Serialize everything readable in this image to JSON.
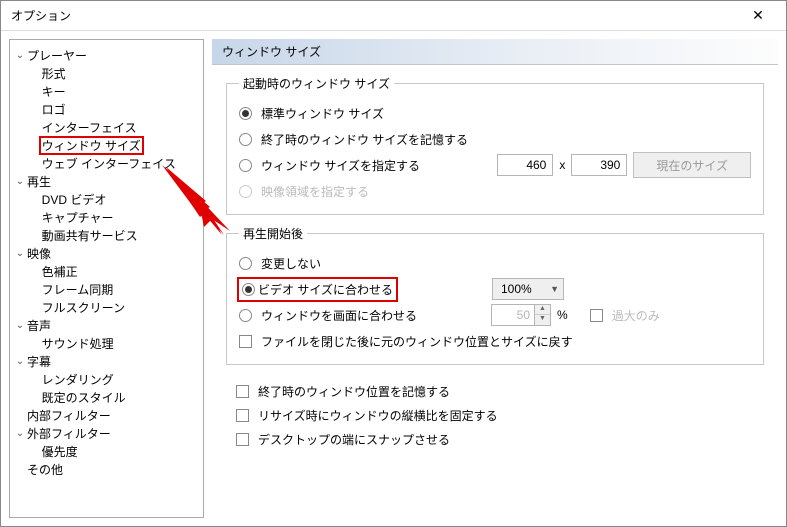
{
  "window": {
    "title": "オプション"
  },
  "tree": {
    "items": [
      {
        "depth": 0,
        "expand": "open",
        "label": "プレーヤー"
      },
      {
        "depth": 1,
        "expand": "",
        "label": "形式"
      },
      {
        "depth": 1,
        "expand": "",
        "label": "キー"
      },
      {
        "depth": 1,
        "expand": "",
        "label": "ロゴ"
      },
      {
        "depth": 1,
        "expand": "",
        "label": "インターフェイス"
      },
      {
        "depth": 1,
        "expand": "",
        "label": "ウィンドウ サイズ",
        "selected": true
      },
      {
        "depth": 1,
        "expand": "",
        "label": "ウェブ インターフェイス"
      },
      {
        "depth": 0,
        "expand": "open",
        "label": "再生"
      },
      {
        "depth": 1,
        "expand": "",
        "label": "DVD ビデオ"
      },
      {
        "depth": 1,
        "expand": "",
        "label": "キャプチャー"
      },
      {
        "depth": 1,
        "expand": "",
        "label": "動画共有サービス"
      },
      {
        "depth": 0,
        "expand": "open",
        "label": "映像"
      },
      {
        "depth": 1,
        "expand": "",
        "label": "色補正"
      },
      {
        "depth": 1,
        "expand": "",
        "label": "フレーム同期"
      },
      {
        "depth": 1,
        "expand": "",
        "label": "フルスクリーン"
      },
      {
        "depth": 0,
        "expand": "open",
        "label": "音声"
      },
      {
        "depth": 1,
        "expand": "",
        "label": "サウンド処理"
      },
      {
        "depth": 0,
        "expand": "open",
        "label": "字幕"
      },
      {
        "depth": 1,
        "expand": "",
        "label": "レンダリング"
      },
      {
        "depth": 1,
        "expand": "",
        "label": "既定のスタイル"
      },
      {
        "depth": 0,
        "expand": "",
        "label": "内部フィルター"
      },
      {
        "depth": 0,
        "expand": "open",
        "label": "外部フィルター"
      },
      {
        "depth": 1,
        "expand": "",
        "label": "優先度"
      },
      {
        "depth": 0,
        "expand": "",
        "label": "その他"
      }
    ]
  },
  "panel": {
    "header": "ウィンドウ サイズ",
    "group_startup": {
      "legend": "起動時のウィンドウ サイズ",
      "opt_standard": "標準ウィンドウ サイズ",
      "opt_last_exit": "終了時のウィンドウ サイズを記憶する",
      "opt_specify": "ウィンドウ サイズを指定する",
      "width": "460",
      "x": "x",
      "height": "390",
      "btn_current": "現在のサイズ",
      "opt_video_region": "映像領域を指定する"
    },
    "group_after": {
      "legend": "再生開始後",
      "opt_nochange": "変更しない",
      "opt_fit_video": "ビデオ サイズに合わせる",
      "fit_percent": "100%",
      "opt_fit_window": "ウィンドウを画面に合わせる",
      "fit_window_val": "50",
      "percent_sign": "%",
      "chk_overscan": "過大のみ",
      "chk_restore_pos": "ファイルを閉じた後に元のウィンドウ位置とサイズに戻す"
    },
    "extras": {
      "chk_remember_pos": "終了時のウィンドウ位置を記憶する",
      "chk_aspect_lock": "リサイズ時にウィンドウの縦横比を固定する",
      "chk_snap": "デスクトップの端にスナップさせる"
    }
  }
}
